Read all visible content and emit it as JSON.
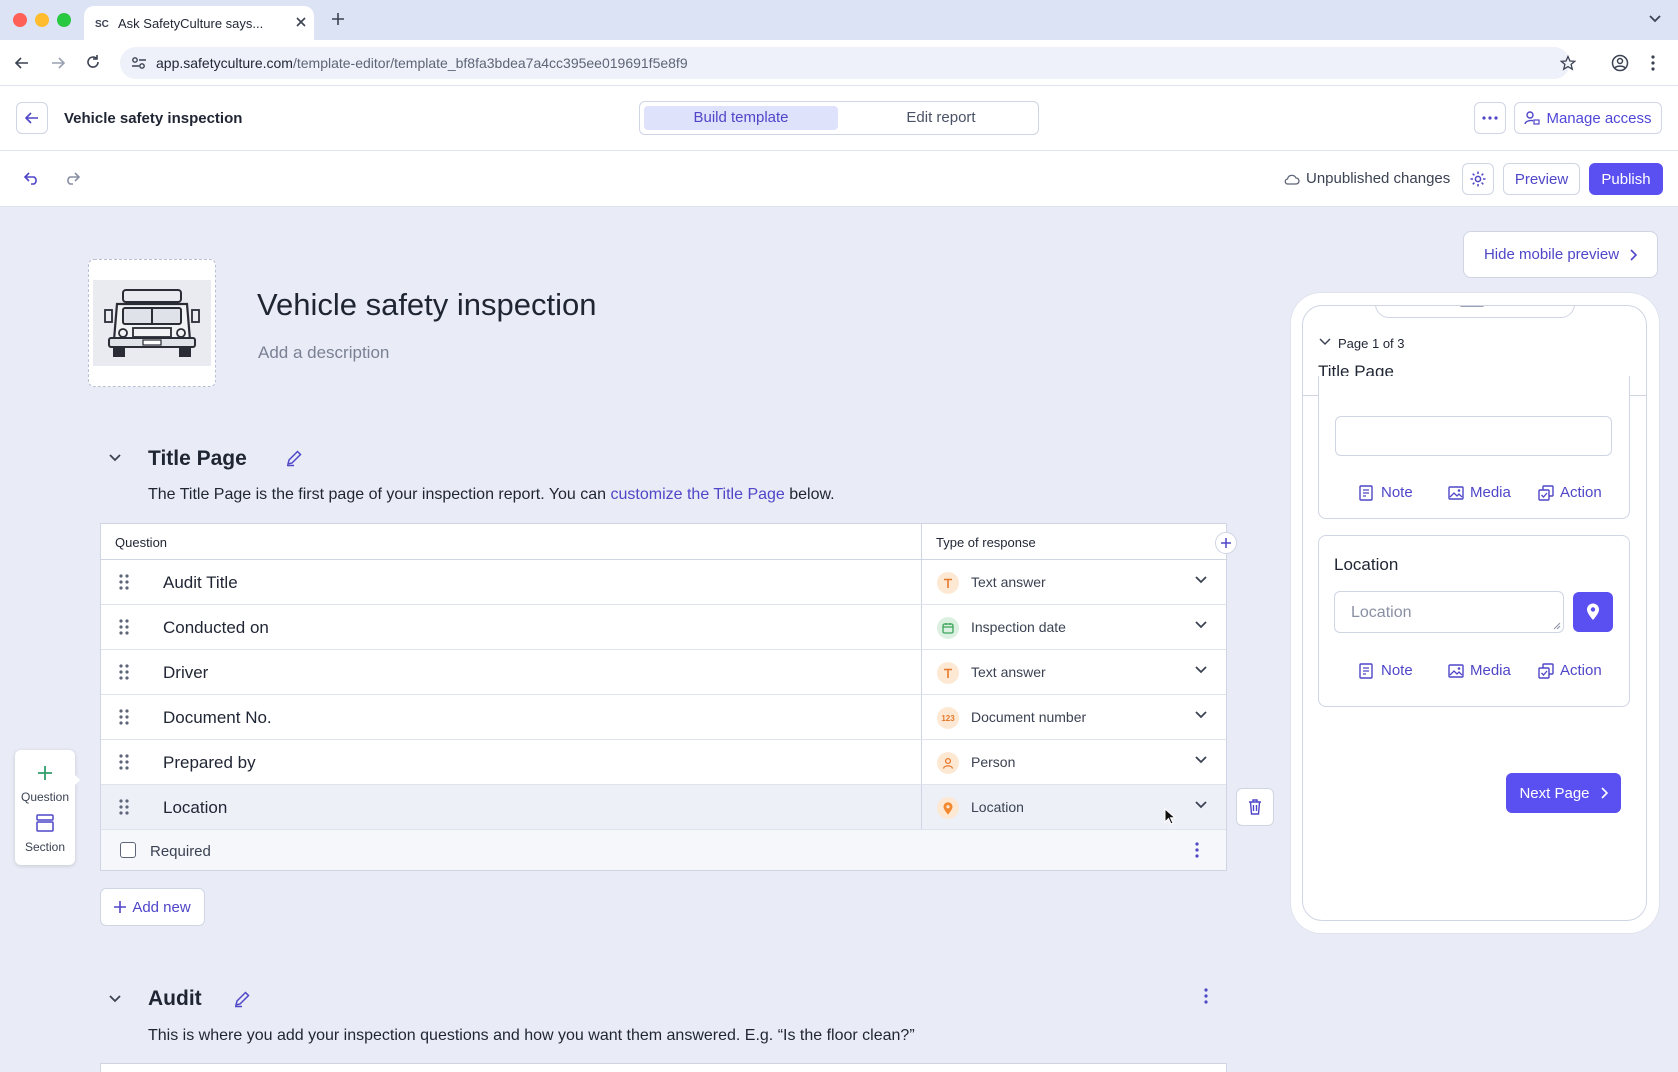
{
  "browser": {
    "tab_title": "Ask SafetyCulture says...",
    "url_domain": "app.safetyculture.com",
    "url_path": "/template-editor/template_bf8fa3bdea7a4cc395ee019691f5e8f9"
  },
  "header": {
    "title": "Vehicle safety inspection",
    "tab_build": "Build template",
    "tab_edit": "Edit report",
    "manage_access": "Manage access"
  },
  "toolbar": {
    "status": "Unpublished changes",
    "preview": "Preview",
    "publish": "Publish"
  },
  "template": {
    "title": "Vehicle safety inspection",
    "description_placeholder": "Add a description"
  },
  "title_page": {
    "heading": "Title Page",
    "desc_before": "The Title Page is the first page of your inspection report. You can ",
    "desc_link": "customize the Title Page",
    "desc_after": " below.",
    "col_question": "Question",
    "col_type": "Type of response",
    "rows": [
      {
        "question": "Audit Title",
        "type": "Text answer"
      },
      {
        "question": "Conducted on",
        "type": "Inspection date"
      },
      {
        "question": "Driver",
        "type": "Text answer"
      },
      {
        "question": "Document No.",
        "type": "Document number"
      },
      {
        "question": "Prepared by",
        "type": "Person"
      },
      {
        "question": "Location",
        "type": "Location"
      }
    ],
    "doc_badge": "123",
    "required_label": "Required",
    "add_new": "Add new"
  },
  "float_panel": {
    "question": "Question",
    "section": "Section"
  },
  "audit": {
    "heading": "Audit",
    "description": "This is where you add your inspection questions and how you want them answered. E.g. “Is the floor clean?”"
  },
  "preview": {
    "hide_button": "Hide mobile preview",
    "page_indicator": "Page 1 of 3",
    "page_title": "Title Page",
    "note": "Note",
    "media": "Media",
    "action": "Action",
    "location_label": "Location",
    "location_placeholder": "Location",
    "next_page": "Next Page"
  },
  "colors": {
    "accent": "#5a4ff0",
    "text_answer": "#f0892f",
    "date": "#3aa55a"
  }
}
